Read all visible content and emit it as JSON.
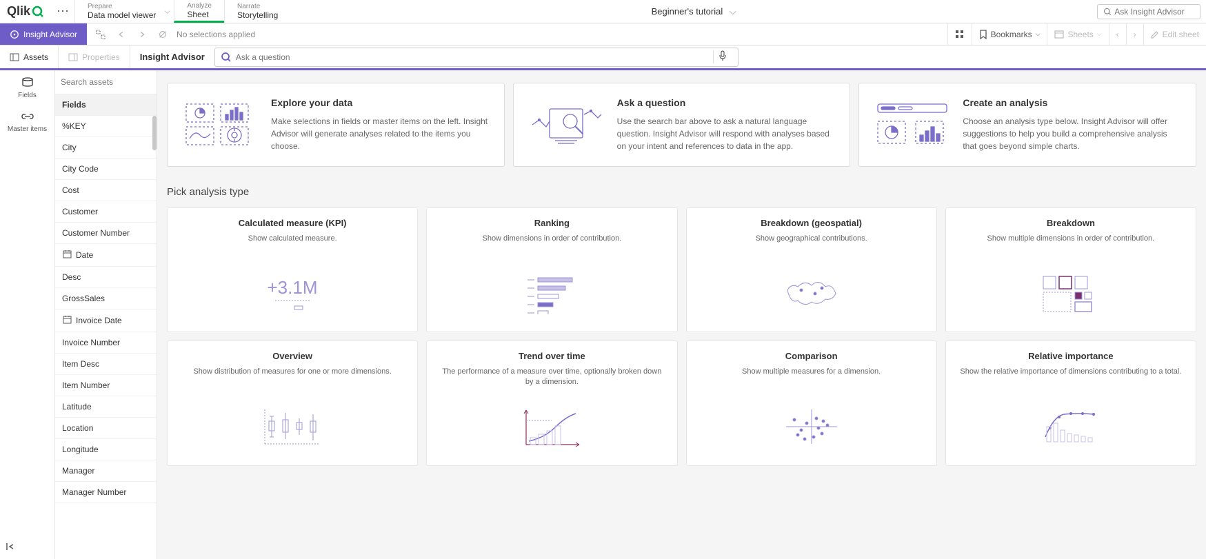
{
  "top": {
    "logo": "Qlik",
    "nav": [
      {
        "small": "Prepare",
        "label": "Data model viewer",
        "chevron": true,
        "active": false
      },
      {
        "small": "Analyze",
        "label": "Sheet",
        "chevron": false,
        "active": true
      },
      {
        "small": "Narrate",
        "label": "Storytelling",
        "chevron": false,
        "active": false
      }
    ],
    "center_title": "Beginner's tutorial",
    "top_search_placeholder": "Ask Insight Advisor"
  },
  "secondbar": {
    "insight_label": "Insight Advisor",
    "no_selections": "No selections applied",
    "bookmarks": "Bookmarks",
    "sheets": "Sheets",
    "edit": "Edit sheet"
  },
  "thirdbar": {
    "assets": "Assets",
    "properties": "Properties",
    "title": "Insight Advisor",
    "question_placeholder": "Ask a question"
  },
  "rail": {
    "fields": "Fields",
    "master": "Master items"
  },
  "assets": {
    "search_placeholder": "Search assets",
    "header": "Fields",
    "items": [
      {
        "label": "%KEY",
        "icon": ""
      },
      {
        "label": "City",
        "icon": ""
      },
      {
        "label": "City Code",
        "icon": ""
      },
      {
        "label": "Cost",
        "icon": ""
      },
      {
        "label": "Customer",
        "icon": ""
      },
      {
        "label": "Customer Number",
        "icon": ""
      },
      {
        "label": "Date",
        "icon": "date"
      },
      {
        "label": "Desc",
        "icon": ""
      },
      {
        "label": "GrossSales",
        "icon": ""
      },
      {
        "label": "Invoice Date",
        "icon": "date"
      },
      {
        "label": "Invoice Number",
        "icon": ""
      },
      {
        "label": "Item Desc",
        "icon": ""
      },
      {
        "label": "Item Number",
        "icon": ""
      },
      {
        "label": "Latitude",
        "icon": ""
      },
      {
        "label": "Location",
        "icon": ""
      },
      {
        "label": "Longitude",
        "icon": ""
      },
      {
        "label": "Manager",
        "icon": ""
      },
      {
        "label": "Manager Number",
        "icon": ""
      }
    ]
  },
  "intro": [
    {
      "title": "Explore your data",
      "desc": "Make selections in fields or master items on the left. Insight Advisor will generate analyses related to the items you choose."
    },
    {
      "title": "Ask a question",
      "desc": "Use the search bar above to ask a natural language question. Insight Advisor will respond with analyses based on your intent and references to data in the app."
    },
    {
      "title": "Create an analysis",
      "desc": "Choose an analysis type below. Insight Advisor will offer suggestions to help you build a comprehensive analysis that goes beyond simple charts."
    }
  ],
  "pick_title": "Pick analysis type",
  "analysis": [
    {
      "title": "Calculated measure (KPI)",
      "desc": "Show calculated measure."
    },
    {
      "title": "Ranking",
      "desc": "Show dimensions in order of contribution."
    },
    {
      "title": "Breakdown (geospatial)",
      "desc": "Show geographical contributions."
    },
    {
      "title": "Breakdown",
      "desc": "Show multiple dimensions in order of contribution."
    },
    {
      "title": "Overview",
      "desc": "Show distribution of measures for one or more dimensions."
    },
    {
      "title": "Trend over time",
      "desc": "The performance of a measure over time, optionally broken down by a dimension."
    },
    {
      "title": "Comparison",
      "desc": "Show multiple measures for a dimension."
    },
    {
      "title": "Relative importance",
      "desc": "Show the relative importance of dimensions contributing to a total."
    }
  ]
}
